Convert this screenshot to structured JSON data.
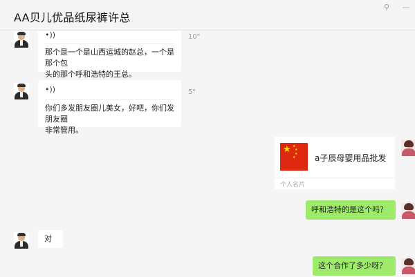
{
  "window": {
    "title": "AA贝儿优品纸尿裤许总",
    "pin_icon": "pin-icon",
    "minimize_icon": "minimize-icon"
  },
  "messages": [
    {
      "type": "voice",
      "sender": "contact",
      "duration": "10\"",
      "transcript": [
        "那个是一个是山西运城的赵总，一个是那个包",
        "头的那个呼和浩特的王总。"
      ]
    },
    {
      "type": "voice",
      "sender": "contact",
      "duration": "5\"",
      "transcript": [
        "你们多发朋友圈儿美女，好吧，你们发朋友圈",
        "非常管用。"
      ]
    },
    {
      "type": "card",
      "sender": "self",
      "card_name": "a子辰母婴用品批发",
      "card_label": "个人名片"
    },
    {
      "type": "text",
      "sender": "self",
      "text": "呼和浩特的是这个吗？"
    },
    {
      "type": "text",
      "sender": "contact",
      "text": "对"
    },
    {
      "type": "text",
      "sender": "self",
      "text": "这个合作了多少呀？"
    }
  ],
  "colors": {
    "self_bubble": "#9eea6a",
    "contact_bubble": "#ffffff",
    "background": "#f5f5f5"
  }
}
